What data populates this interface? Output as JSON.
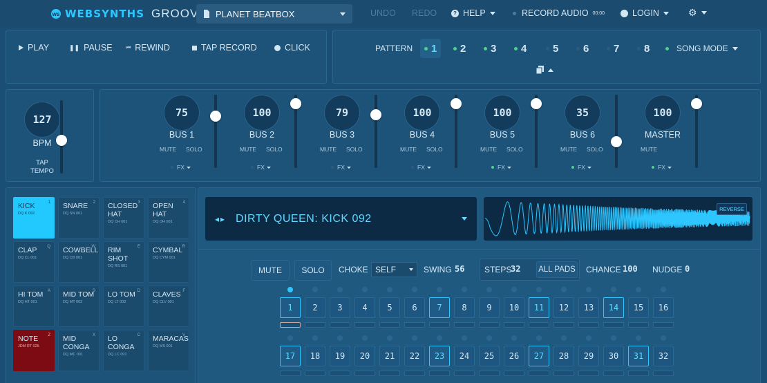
{
  "app": {
    "brand": "WEBSYNTHS",
    "subtitle": "GROOVES",
    "mark": "ws"
  },
  "kit": {
    "name": "PLANET BEATBOX"
  },
  "menu": {
    "undo": "UNDO",
    "redo": "REDO",
    "help": "HELP",
    "record": "RECORD AUDIO",
    "record_time": "00:00",
    "login": "LOGIN"
  },
  "transport": {
    "play": "PLAY",
    "pause": "PAUSE",
    "rewind": "REWIND",
    "tap_record": "TAP RECORD",
    "click": "CLICK"
  },
  "patterns": {
    "label": "PATTERN",
    "items": [
      {
        "n": "1",
        "active": true,
        "dot": true
      },
      {
        "n": "2",
        "dot": true
      },
      {
        "n": "3",
        "dot": true
      },
      {
        "n": "4",
        "dot": true
      },
      {
        "n": "5",
        "dot": false
      },
      {
        "n": "6",
        "dot": false
      },
      {
        "n": "7",
        "dot": false
      },
      {
        "n": "8",
        "dot": false
      }
    ],
    "song_mode": "SONG MODE"
  },
  "tempo": {
    "bpm": "127",
    "label": "BPM",
    "tap": "TAP TEMPO",
    "level": 0.45
  },
  "mixer": [
    {
      "name": "BUS 1",
      "value": "75",
      "level": 0.74,
      "mute": "MUTE",
      "solo": "SOLO",
      "fx": "FX",
      "fx_on": false
    },
    {
      "name": "BUS 2",
      "value": "100",
      "level": 0.95,
      "mute": "MUTE",
      "solo": "SOLO",
      "fx": "FX",
      "fx_on": false
    },
    {
      "name": "BUS 3",
      "value": "79",
      "level": 0.77,
      "mute": "MUTE",
      "solo": "SOLO",
      "fx": "FX",
      "fx_on": false
    },
    {
      "name": "BUS 4",
      "value": "100",
      "level": 0.95,
      "mute": "MUTE",
      "solo": "SOLO",
      "fx": "FX",
      "fx_on": false
    },
    {
      "name": "BUS 5",
      "value": "100",
      "level": 0.95,
      "mute": "MUTE",
      "solo": "SOLO",
      "fx": "FX",
      "fx_on": true
    },
    {
      "name": "BUS 6",
      "value": "35",
      "level": 0.33,
      "mute": "MUTE",
      "solo": "SOLO",
      "fx": "FX",
      "fx_on": true
    },
    {
      "name": "MASTER",
      "value": "100",
      "level": 0.95,
      "mute": "MUTE",
      "solo": "",
      "fx": "FX",
      "fx_on": true
    }
  ],
  "pads": [
    {
      "name": "KICK",
      "code": "DQ K 092",
      "key": "1",
      "state": "selected"
    },
    {
      "name": "SNARE",
      "code": "DQ SN 001",
      "key": "2"
    },
    {
      "name": "CLOSED HAT",
      "code": "DQ CH 001",
      "key": "3"
    },
    {
      "name": "OPEN HAT",
      "code": "DQ OH 001",
      "key": "4"
    },
    {
      "name": "CLAP",
      "code": "DQ CL 001",
      "key": "Q"
    },
    {
      "name": "COWBELL",
      "code": "DQ CB 001",
      "key": "W"
    },
    {
      "name": "RIM SHOT",
      "code": "DQ RS 001",
      "key": "E"
    },
    {
      "name": "CYMBAL",
      "code": "DQ CYM 001",
      "key": "R"
    },
    {
      "name": "HI TOM",
      "code": "DQ HT 001",
      "key": "A"
    },
    {
      "name": "MID TOM",
      "code": "DQ MT 002",
      "key": "S"
    },
    {
      "name": "LO TOM",
      "code": "DQ LT 002",
      "key": "D"
    },
    {
      "name": "CLAVES",
      "code": "DQ CLV 001",
      "key": "F"
    },
    {
      "name": "NOTE",
      "code": "JDM RT 025",
      "key": "Z",
      "state": "red"
    },
    {
      "name": "MID CONGA",
      "code": "DQ MC 001",
      "key": "X"
    },
    {
      "name": "LO CONGA",
      "code": "DQ LC 001",
      "key": "C"
    },
    {
      "name": "MARACAS",
      "code": "DQ MS 001",
      "key": "V"
    }
  ],
  "sample": {
    "title": "DIRTY QUEEN: KICK 092",
    "reverse": "REVERSE"
  },
  "controls": {
    "mute": "MUTE",
    "solo": "SOLO",
    "choke_label": "CHOKE",
    "choke_value": "SELF",
    "swing_label": "SWING",
    "swing_value": "56",
    "steps_label": "STEPS",
    "steps_value": "32",
    "all_pads": "ALL PADS",
    "chance_label": "CHANCE",
    "chance_value": "100",
    "nudge_label": "NUDGE",
    "nudge_value": "0"
  },
  "steps": {
    "active": [
      1,
      7,
      11,
      14,
      17,
      23,
      27,
      31
    ],
    "current": 1,
    "labels": [
      "1",
      "2",
      "3",
      "4",
      "5",
      "6",
      "7",
      "8",
      "9",
      "10",
      "11",
      "12",
      "13",
      "14",
      "15",
      "16",
      "17",
      "18",
      "19",
      "20",
      "21",
      "22",
      "23",
      "24",
      "25",
      "26",
      "27",
      "28",
      "29",
      "30",
      "31",
      "32"
    ]
  },
  "colors": {
    "accent": "#2dc6ff",
    "selected_pad": "#22c9ff",
    "note_pad": "#7d0b14",
    "green": "#4fd08f"
  }
}
